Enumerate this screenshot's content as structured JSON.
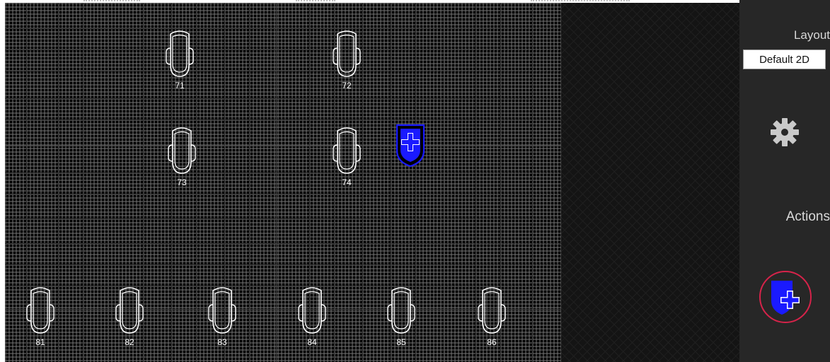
{
  "seats": [
    {
      "id": "seat-71",
      "label": "71"
    },
    {
      "id": "seat-72",
      "label": "72"
    },
    {
      "id": "seat-73",
      "label": "73"
    },
    {
      "id": "seat-74",
      "label": "74"
    },
    {
      "id": "seat-81",
      "label": "81"
    },
    {
      "id": "seat-82",
      "label": "82"
    },
    {
      "id": "seat-83",
      "label": "83"
    },
    {
      "id": "seat-84",
      "label": "84"
    },
    {
      "id": "seat-85",
      "label": "85"
    },
    {
      "id": "seat-86",
      "label": "86"
    }
  ],
  "placed_item": {
    "icon": "shield-plus-icon",
    "color": "#1a1aff"
  },
  "sidebar": {
    "layout_title": "Layout",
    "layout_value": "Default 2D",
    "settings_icon": "gear-icon",
    "actions_title": "Actions",
    "add_icon": "shield-plus-icon",
    "add_icon_color": "#1a1aff",
    "highlight_color": "#d6234a"
  },
  "colors": {
    "canvas_bg": "#000000",
    "seat_stroke": "#ffffff",
    "sidebar_bg": "#272727"
  }
}
